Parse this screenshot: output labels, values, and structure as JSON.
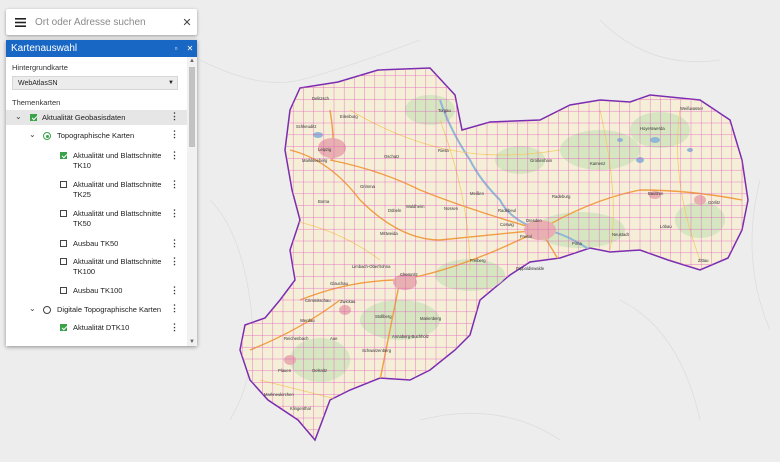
{
  "search": {
    "placeholder": "Ort oder Adresse suchen",
    "menu_icon": "hamburger-menu-icon",
    "clear_icon": "close-icon"
  },
  "panel": {
    "title": "Kartenauswahl",
    "hintergrund_label": "Hintergrundkarte",
    "hintergrund_value": "WebAtlasSN",
    "themen_label": "Themenkarten",
    "group": {
      "label": "Aktualität Geobasisdaten",
      "checked": true
    },
    "subgroups": [
      {
        "label": "Topographische Karten",
        "selected": true,
        "items": [
          {
            "label": "Aktualität und Blattschnitte TK10",
            "checked": true
          },
          {
            "label": "Aktualität und Blattschnitte TK25",
            "checked": false
          },
          {
            "label": "Aktualität und Blattschnitte TK50",
            "checked": false
          },
          {
            "label": "Ausbau TK50",
            "checked": false
          },
          {
            "label": "Aktualität und Blattschnitte TK100",
            "checked": false
          },
          {
            "label": "Ausbau TK100",
            "checked": false
          }
        ]
      },
      {
        "label": "Digitale Topographische Karten",
        "selected": false,
        "items": [
          {
            "label": "Aktualität DTK10",
            "checked": true
          }
        ]
      }
    ]
  },
  "map": {
    "places": [
      "Delitzsch",
      "Eilenburg",
      "Leipzig",
      "Schkeuditz",
      "Markkleeberg",
      "Borna",
      "Grimma",
      "Torgau",
      "Oschatz",
      "Döbeln",
      "Riesa",
      "Meißen",
      "Großenhain",
      "Radeburg",
      "Kamenz",
      "Hoyerswerda",
      "Weißwasser",
      "Bautzen",
      "Löbau",
      "Görlitz",
      "Zittau",
      "Neustadt",
      "Dresden",
      "Freital",
      "Pirna",
      "Radebeul",
      "Freiberg",
      "Mittweida",
      "Chemnitz",
      "Glauchau",
      "Zwickau",
      "Crimmitschau",
      "Werdau",
      "Reichenbach",
      "Plauen",
      "Aue",
      "Annaberg-Buchholz",
      "Marienberg",
      "Oelsnitz",
      "Klingenthal",
      "Limbach-Oberfrohna",
      "Waldheim",
      "Nossen",
      "Coswig",
      "Dippoldiswalde",
      "Stollberg",
      "Schwarzenberg",
      "Markneukirchen"
    ],
    "colors": {
      "border": "#7a2bb0",
      "grid": "#e060c0",
      "road": "#f2a23a",
      "water": "#9cc3de",
      "forest": "#c9e2b6"
    }
  }
}
